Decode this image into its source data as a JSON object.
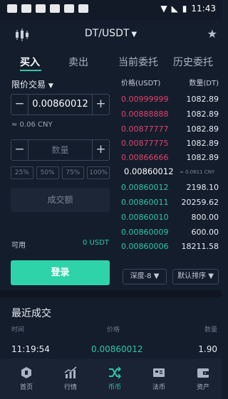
{
  "status_bar": {
    "time": "11:43"
  },
  "header": {
    "pair": "DT/USDT",
    "caret": "▼"
  },
  "tabs": [
    "买入",
    "卖出",
    "当前委托",
    "历史委托"
  ],
  "order_form": {
    "order_type": "限价交易",
    "order_type_caret": "▼",
    "price_value": "0.00860012",
    "cny_estimate": "≈ 0.06 CNY",
    "amount_placeholder": "数量",
    "percent_buttons": [
      "25%",
      "50%",
      "75%",
      "100%"
    ],
    "total_label": "成交额",
    "available_label": "可用",
    "available_value": "0 USDT",
    "submit_label": "登录"
  },
  "order_book": {
    "price_header": "价格(USDT)",
    "qty_header": "数量(DT)",
    "asks": [
      {
        "price": "0.00999999",
        "qty": "1082.89"
      },
      {
        "price": "0.00888888",
        "qty": "1082.89"
      },
      {
        "price": "0.00877777",
        "qty": "1082.89"
      },
      {
        "price": "0.00877775",
        "qty": "1082.89"
      },
      {
        "price": "0.00866666",
        "qty": "1082.89"
      }
    ],
    "last_price": "0.00860012",
    "last_price_cny": "≈ 0.0611 CNY",
    "bids": [
      {
        "price": "0.00860012",
        "qty": "2198.10"
      },
      {
        "price": "0.00860011",
        "qty": "20259.62"
      },
      {
        "price": "0.00860010",
        "qty": "800.00"
      },
      {
        "price": "0.00860009",
        "qty": "600.00"
      },
      {
        "price": "0.00860006",
        "qty": "18211.58"
      }
    ],
    "depth_label": "深度-8 ▼",
    "sort_label": "默认排序 ▼"
  },
  "recent_trades": {
    "title": "最近成交",
    "headers": [
      "时间",
      "价格",
      "数量"
    ],
    "rows": [
      {
        "time": "11:19:54",
        "price": "0.00860012",
        "qty": "1.90"
      }
    ]
  },
  "bottom_nav": [
    {
      "label": "首页",
      "icon": "home-icon"
    },
    {
      "label": "行情",
      "icon": "chart-icon"
    },
    {
      "label": "币币",
      "icon": "exchange-icon"
    },
    {
      "label": "法币",
      "icon": "fiat-icon"
    },
    {
      "label": "资产",
      "icon": "wallet-icon"
    }
  ],
  "colors": {
    "accent": "#2fc7a6",
    "ask": "#e0436c",
    "background": "#141d2c",
    "button": "#2ed3a9"
  }
}
